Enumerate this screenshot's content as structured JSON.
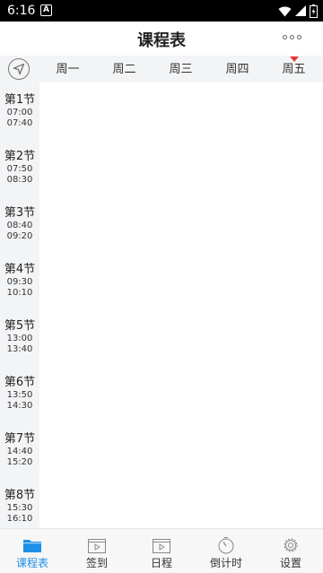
{
  "status_bar": {
    "time": "6:16",
    "notification_icon": "A",
    "icons": [
      "wifi-icon",
      "signal-icon",
      "battery-icon"
    ]
  },
  "header": {
    "title": "课程表",
    "more_icon": "more-icon"
  },
  "week": {
    "locate_icon": "navigation-icon",
    "days": [
      "周一",
      "周二",
      "周三",
      "周四",
      "周五"
    ],
    "current_day_index": 4
  },
  "periods": [
    {
      "label": "第1节",
      "start": "07:00",
      "end": "07:40"
    },
    {
      "label": "第2节",
      "start": "07:50",
      "end": "08:30"
    },
    {
      "label": "第3节",
      "start": "08:40",
      "end": "09:20"
    },
    {
      "label": "第4节",
      "start": "09:30",
      "end": "10:10"
    },
    {
      "label": "第5节",
      "start": "13:00",
      "end": "13:40"
    },
    {
      "label": "第6节",
      "start": "13:50",
      "end": "14:30"
    },
    {
      "label": "第7节",
      "start": "14:40",
      "end": "15:20"
    },
    {
      "label": "第8节",
      "start": "15:30",
      "end": "16:10"
    }
  ],
  "tabs": [
    {
      "label": "课程表",
      "icon": "folder-icon",
      "active": true
    },
    {
      "label": "签到",
      "icon": "video-icon",
      "active": false
    },
    {
      "label": "日程",
      "icon": "video-icon",
      "active": false
    },
    {
      "label": "倒计时",
      "icon": "timer-icon",
      "active": false
    },
    {
      "label": "设置",
      "icon": "gear-icon",
      "active": false
    }
  ],
  "colors": {
    "accent": "#1d90e8",
    "current_day_marker": "#e53935",
    "week_row_bg": "#f3f4f6"
  }
}
